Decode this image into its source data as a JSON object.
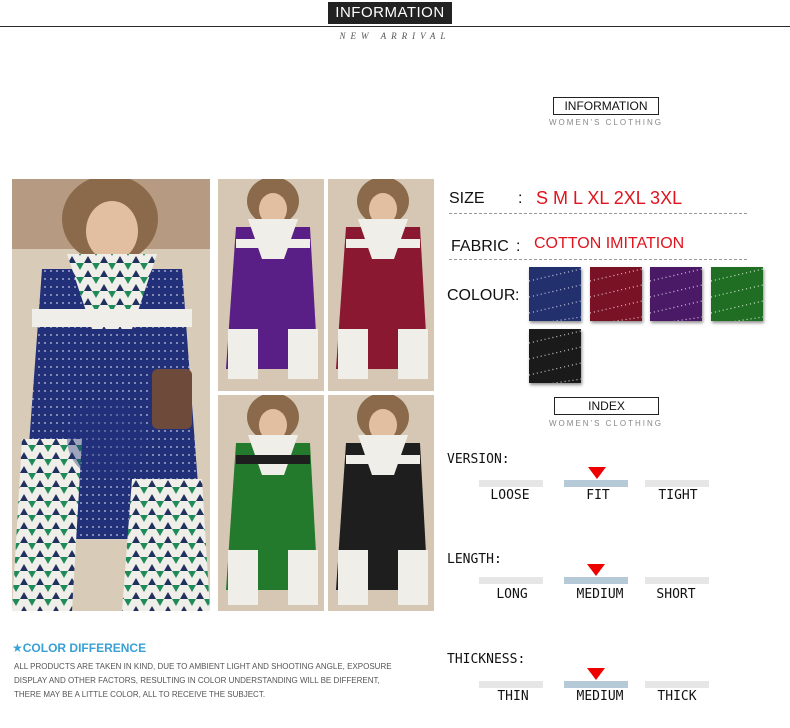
{
  "header": {
    "title": "INFORMATION",
    "subtitle": "NEW ARRIVAL"
  },
  "info_section": {
    "title": "INFORMATION",
    "caption": "WOMEN'S CLOTHING"
  },
  "specs": {
    "size_label": "SIZE",
    "size_sep": ":",
    "size_value": "S M L XL 2XL 3XL",
    "fabric_label": "FABRIC",
    "fabric_sep": ":",
    "fabric_value": "COTTON IMITATION",
    "colour_label": "COLOUR",
    "colour_sep": ":",
    "colours": [
      "#23306e",
      "#7a1226",
      "#4a1a66",
      "#1f6e24",
      "#1a1a1a"
    ]
  },
  "index_section": {
    "title": "INDEX",
    "caption": "WOMEN'S CLOTHING",
    "version": {
      "label": "VERSION:",
      "options": [
        "LOOSE",
        "FIT",
        "TIGHT"
      ],
      "selected": 1
    },
    "length": {
      "label": "LENGTH:",
      "options": [
        "LONG",
        "MEDIUM",
        "SHORT"
      ],
      "selected": 1
    },
    "thickness": {
      "label": "THICKNESS:",
      "options": [
        "THIN",
        "MEDIUM",
        "THICK"
      ],
      "selected": 1
    }
  },
  "color_difference": {
    "title": "★COLOR DIFFERENCE",
    "line1": "ALL PRODUCTS ARE TAKEN IN KIND, DUE TO AMBIENT LIGHT AND SHOOTING ANGLE, EXPOSURE",
    "line2": "DISPLAY AND OTHER FACTORS, RESULTING IN COLOR UNDERSTANDING WILL BE DIFFERENT,",
    "line3": "THERE MAY BE A LITTLE COLOR, ALL TO RECEIVE THE SUBJECT."
  },
  "photos": {
    "main_color": "#22307a",
    "colors": [
      "#5a1f86",
      "#8a1830",
      "#237a2c",
      "#1e1e1e"
    ]
  }
}
